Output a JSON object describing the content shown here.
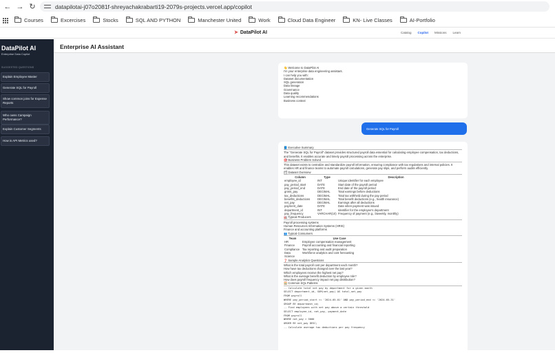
{
  "browser": {
    "url": "datapilotai-j07o2081f-shreyachakrabarti19-2079s-projects.vercel.app/copilot",
    "bookmarks": [
      "Courses",
      "Excercises",
      "Stocks",
      "SQL AND PYTHON",
      "Manchester United",
      "Work",
      "Cloud Data Engineer",
      "KN- Live Classes",
      "AI-Portfolio"
    ]
  },
  "topnav": {
    "brand": "DataPilot AI",
    "links": [
      "Catalog",
      "Copilot",
      "Missions",
      "Learn"
    ]
  },
  "sidebar": {
    "title": "DataPilot AI",
    "subtitle": "Enterprise Data Copilot",
    "section": "SUGGESTED QUESTIONS",
    "items": [
      "Explain Employee Master",
      "Generate SQL for Payroll",
      "Show common joins for Expense Reports",
      "Who owns Campaign Performance?",
      "Explain Customer Segments",
      "How is API Metrics used?"
    ]
  },
  "main": {
    "title": "Enterprise AI Assistant"
  },
  "welcome": {
    "lines": [
      "👋 Welcome to DataPilot AI",
      "I'm your enterprise data engineering assistant.",
      "I can help you with:",
      "Dataset documentation",
      "SQL generation",
      "Data lineage",
      "Governance",
      "Data quality",
      "Learning recommendations",
      "Business context"
    ]
  },
  "user_message": "Generate SQL for Payroll",
  "response": {
    "exec_title": "📘 Executive Summary",
    "exec_text": "The \"Generate SQL for Payroll\" dataset provides structured payroll data essential for calculating employee compensation, tax deductions, and benefits. It enables accurate and timely payroll processing across the enterprise.",
    "problem_title": "🎯 Business Problem Solved",
    "problem_text": "This dataset exists to centralize and standardize payroll information, ensuring compliance with tax regulations and internal policies. It enables HR and finance teams to automate payroll calculations, generate pay slips, and perform audits efficiently.",
    "overview_title": "🗂 Dataset Overview",
    "overview_headers": [
      "Column",
      "Type",
      "Description"
    ],
    "overview_rows": [
      [
        "employee_id",
        "INT",
        "Unique identifier for each employee"
      ],
      [
        "pay_period_start",
        "DATE",
        "Start date of the payroll period"
      ],
      [
        "pay_period_end",
        "DATE",
        "End date of the payroll period"
      ],
      [
        "gross_pay",
        "DECIMAL",
        "Total earnings before deductions"
      ],
      [
        "tax_deductions",
        "DECIMAL",
        "Total tax withheld during the pay period"
      ],
      [
        "benefits_deductions",
        "DECIMAL",
        "Total benefit deductions (e.g., health insurance)"
      ],
      [
        "net_pay",
        "DECIMAL",
        "Earnings after all deductions"
      ],
      [
        "payment_date",
        "DATE",
        "Date when payment was issued"
      ],
      [
        "department_id",
        "INT",
        "Identifier for the employee's department"
      ],
      [
        "pay_frequency",
        "VARCHAR(10)",
        "Frequency of payment (e.g., biweekly, monthly)"
      ]
    ],
    "producers_title": "🏭 Typical Producers",
    "producers": [
      "Payroll processing systems",
      "Human Resources Information Systems (HRIS)",
      "Finance and accounting platforms"
    ],
    "consumers_title": "👥 Typical Consumers",
    "consumer_headers": [
      "Team",
      "Use Case"
    ],
    "consumer_rows": [
      [
        "HR",
        "Employee compensation management"
      ],
      [
        "Finance",
        "Payroll accounting and financial reporting"
      ],
      [
        "Compliance",
        "Tax reporting and audit preparation"
      ],
      [
        "Data Science",
        "Workforce analytics and cost forecasting"
      ]
    ],
    "questions_title": "❓ Sample Analytics Questions",
    "questions": [
      "What is the total payroll cost per department each month?",
      "How have tax deductions changed over the last year?",
      "Which employees receive the highest net pay?",
      "What is the average benefit deduction by employee role?",
      "How does payroll frequency impact net pay distribution?"
    ],
    "sql_title": "🧮 Common SQL Patterns",
    "sql_lines": [
      "-- Calculate total net pay by department for a given month",
      "SELECT department_id, SUM(net_pay) AS total_net_pay",
      "FROM payroll",
      "WHERE pay_period_start >= '2024-05-01' AND pay_period_end <= '2024-05-31'",
      "GROUP BY department_id;",
      "-- Find employees with net pay above a certain threshold",
      "SELECT employee_id, net_pay, payment_date",
      "FROM payroll",
      "WHERE net_pay > 5000",
      "ORDER BY net_pay DESC;",
      "-- Calculate average tax deductions per pay frequency"
    ]
  }
}
